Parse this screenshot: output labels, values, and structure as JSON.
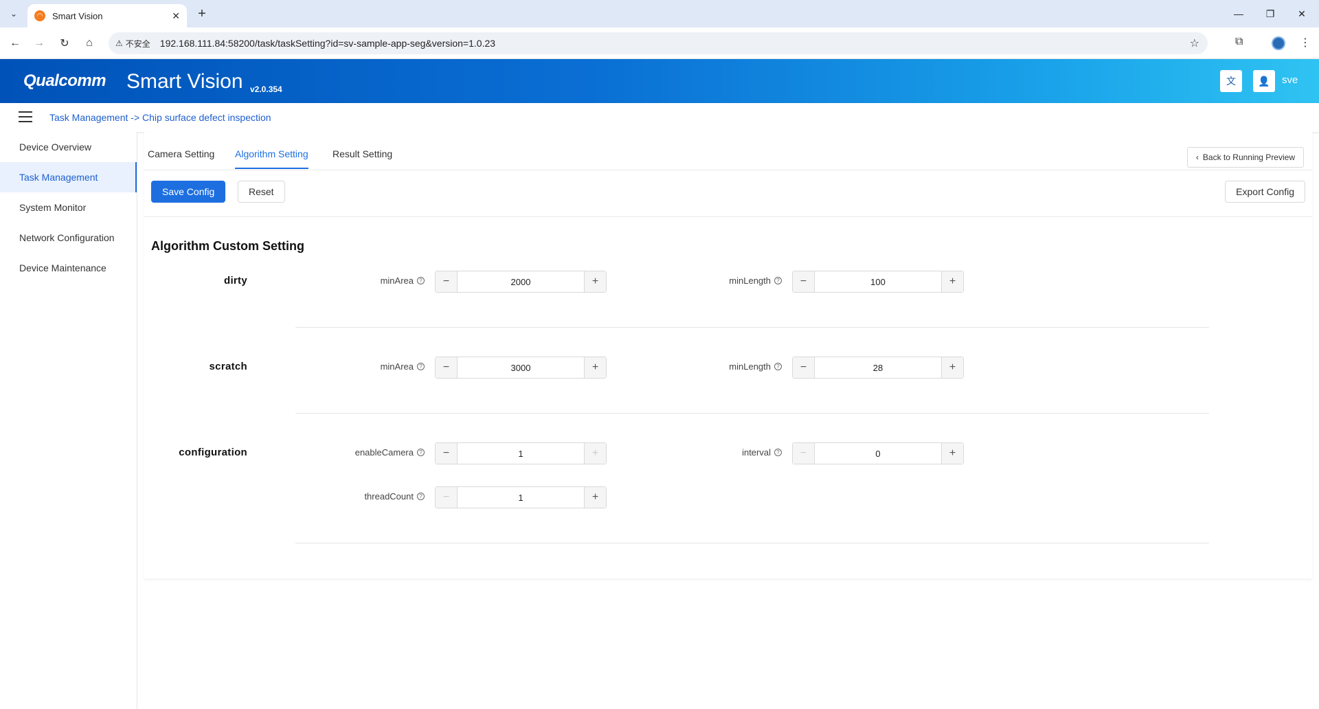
{
  "browser": {
    "tab_title": "Smart Vision",
    "tab_close": "✕",
    "new_tab": "+",
    "security_label": "不安全",
    "url": "192.168.111.84:58200/task/taskSetting?id=sv-sample-app-seg&version=1.0.23"
  },
  "header": {
    "logo": "Qualcomm",
    "app_name": "Smart Vision",
    "version": "v2.0.354",
    "username": "sve"
  },
  "breadcrumb": "Task Management -> Chip surface defect inspection",
  "sidebar": {
    "items": [
      {
        "label": "Device Overview"
      },
      {
        "label": "Task Management"
      },
      {
        "label": "System Monitor"
      },
      {
        "label": "Network Configuration"
      },
      {
        "label": "Device Maintenance"
      }
    ]
  },
  "tabs": {
    "camera": "Camera Setting",
    "algorithm": "Algorithm Setting",
    "result": "Result Setting"
  },
  "back_button": "Back to Running Preview",
  "actions": {
    "save": "Save Config",
    "reset": "Reset",
    "export": "Export Config"
  },
  "section_title": "Algorithm Custom Setting",
  "groups": {
    "dirty": {
      "label": "dirty",
      "minArea": {
        "label": "minArea",
        "value": "2000"
      },
      "minLength": {
        "label": "minLength",
        "value": "100"
      }
    },
    "scratch": {
      "label": "scratch",
      "minArea": {
        "label": "minArea",
        "value": "3000"
      },
      "minLength": {
        "label": "minLength",
        "value": "28"
      }
    },
    "configuration": {
      "label": "configuration",
      "enableCamera": {
        "label": "enableCamera",
        "value": "1"
      },
      "interval": {
        "label": "interval",
        "value": "0"
      },
      "threadCount": {
        "label": "threadCount",
        "value": "1"
      }
    }
  },
  "colors": {
    "primary": "#1d6fe0",
    "header_start": "#0052b8",
    "header_end": "#2fc3f2",
    "link": "#1d5fcf"
  }
}
